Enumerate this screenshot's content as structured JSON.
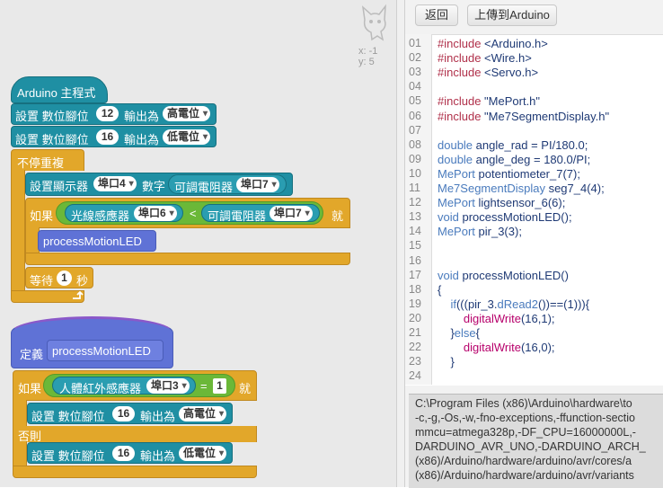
{
  "toolbar": {
    "back_label": "返回",
    "upload_label": "上傳到Arduino"
  },
  "sprite": {
    "x_label": "x: -1",
    "y_label": "y: 5"
  },
  "code_lines": [
    {
      "n": "01",
      "t": "#include <Arduino.h>"
    },
    {
      "n": "02",
      "t": "#include <Wire.h>"
    },
    {
      "n": "03",
      "t": "#include <Servo.h>"
    },
    {
      "n": "04",
      "t": ""
    },
    {
      "n": "05",
      "t": "#include \"MePort.h\""
    },
    {
      "n": "06",
      "t": "#include \"Me7SegmentDisplay.h\""
    },
    {
      "n": "07",
      "t": ""
    },
    {
      "n": "08",
      "t": "double angle_rad = PI/180.0;"
    },
    {
      "n": "09",
      "t": "double angle_deg = 180.0/PI;"
    },
    {
      "n": "10",
      "t": "MePort potentiometer_7(7);"
    },
    {
      "n": "11",
      "t": "Me7SegmentDisplay seg7_4(4);"
    },
    {
      "n": "12",
      "t": "MePort lightsensor_6(6);"
    },
    {
      "n": "13",
      "t": "void processMotionLED();"
    },
    {
      "n": "14",
      "t": "MePort pir_3(3);"
    },
    {
      "n": "15",
      "t": ""
    },
    {
      "n": "16",
      "t": ""
    },
    {
      "n": "17",
      "t": "void processMotionLED()"
    },
    {
      "n": "18",
      "t": "{"
    },
    {
      "n": "19",
      "t": "    if(((pir_3.dRead2())==(1))){"
    },
    {
      "n": "20",
      "t": "        digitalWrite(16,1);"
    },
    {
      "n": "21",
      "t": "    }else{"
    },
    {
      "n": "22",
      "t": "        digitalWrite(16,0);"
    },
    {
      "n": "23",
      "t": "    }"
    },
    {
      "n": "24",
      "t": ""
    }
  ],
  "console_lines": [
    "C:\\Program Files (x86)\\Arduino\\hardware\\to",
    "-c,-g,-Os,-w,-fno-exceptions,-ffunction-sectio",
    "mmcu=atmega328p,-DF_CPU=16000000L,-",
    "DARDUINO_AVR_UNO,-DARDUINO_ARCH_",
    "(x86)/Arduino/hardware/arduino/avr/cores/a",
    "(x86)/Arduino/hardware/arduino/avr/variants"
  ],
  "blocks": {
    "hat": "Arduino 主程式",
    "set_pin": "設置 數位腳位",
    "output_as": "輸出為",
    "pin12": "12",
    "pin16": "16",
    "high": "高電位",
    "low": "低電位",
    "forever": "不停重複",
    "set_display": "設置顯示器",
    "port4": "埠口4",
    "number": "數字",
    "pot": "可調電阻器",
    "port7": "埠口7",
    "if": "如果",
    "light_sensor": "光線感應器",
    "port6": "埠口6",
    "lt": "<",
    "then": "就",
    "call": "processMotionLED",
    "wait": "等待",
    "wait_val": "1",
    "seconds": "秒",
    "define": "定義",
    "def_name": "processMotionLED",
    "pir": "人體紅外感應器",
    "port3": "埠口3",
    "eq": "=",
    "eq_val": "1",
    "else": "否則"
  }
}
